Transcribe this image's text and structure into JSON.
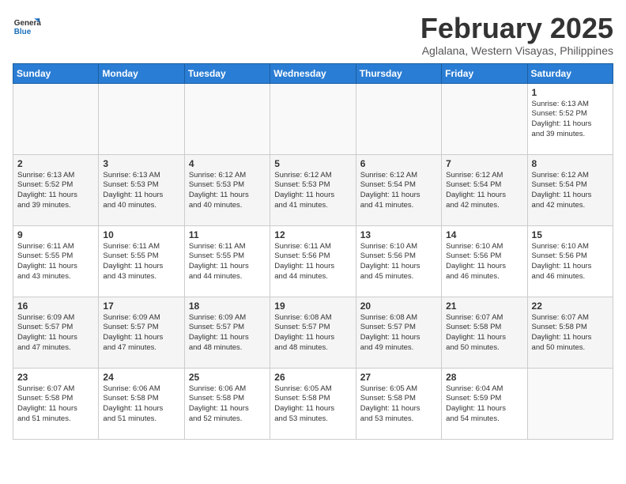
{
  "header": {
    "logo_general": "General",
    "logo_blue": "Blue",
    "title": "February 2025",
    "subtitle": "Aglalana, Western Visayas, Philippines"
  },
  "weekdays": [
    "Sunday",
    "Monday",
    "Tuesday",
    "Wednesday",
    "Thursday",
    "Friday",
    "Saturday"
  ],
  "weeks": [
    [
      {
        "day": "",
        "info": ""
      },
      {
        "day": "",
        "info": ""
      },
      {
        "day": "",
        "info": ""
      },
      {
        "day": "",
        "info": ""
      },
      {
        "day": "",
        "info": ""
      },
      {
        "day": "",
        "info": ""
      },
      {
        "day": "1",
        "info": "Sunrise: 6:13 AM\nSunset: 5:52 PM\nDaylight: 11 hours\nand 39 minutes."
      }
    ],
    [
      {
        "day": "2",
        "info": "Sunrise: 6:13 AM\nSunset: 5:52 PM\nDaylight: 11 hours\nand 39 minutes."
      },
      {
        "day": "3",
        "info": "Sunrise: 6:13 AM\nSunset: 5:53 PM\nDaylight: 11 hours\nand 40 minutes."
      },
      {
        "day": "4",
        "info": "Sunrise: 6:12 AM\nSunset: 5:53 PM\nDaylight: 11 hours\nand 40 minutes."
      },
      {
        "day": "5",
        "info": "Sunrise: 6:12 AM\nSunset: 5:53 PM\nDaylight: 11 hours\nand 41 minutes."
      },
      {
        "day": "6",
        "info": "Sunrise: 6:12 AM\nSunset: 5:54 PM\nDaylight: 11 hours\nand 41 minutes."
      },
      {
        "day": "7",
        "info": "Sunrise: 6:12 AM\nSunset: 5:54 PM\nDaylight: 11 hours\nand 42 minutes."
      },
      {
        "day": "8",
        "info": "Sunrise: 6:12 AM\nSunset: 5:54 PM\nDaylight: 11 hours\nand 42 minutes."
      }
    ],
    [
      {
        "day": "9",
        "info": "Sunrise: 6:11 AM\nSunset: 5:55 PM\nDaylight: 11 hours\nand 43 minutes."
      },
      {
        "day": "10",
        "info": "Sunrise: 6:11 AM\nSunset: 5:55 PM\nDaylight: 11 hours\nand 43 minutes."
      },
      {
        "day": "11",
        "info": "Sunrise: 6:11 AM\nSunset: 5:55 PM\nDaylight: 11 hours\nand 44 minutes."
      },
      {
        "day": "12",
        "info": "Sunrise: 6:11 AM\nSunset: 5:56 PM\nDaylight: 11 hours\nand 44 minutes."
      },
      {
        "day": "13",
        "info": "Sunrise: 6:10 AM\nSunset: 5:56 PM\nDaylight: 11 hours\nand 45 minutes."
      },
      {
        "day": "14",
        "info": "Sunrise: 6:10 AM\nSunset: 5:56 PM\nDaylight: 11 hours\nand 46 minutes."
      },
      {
        "day": "15",
        "info": "Sunrise: 6:10 AM\nSunset: 5:56 PM\nDaylight: 11 hours\nand 46 minutes."
      }
    ],
    [
      {
        "day": "16",
        "info": "Sunrise: 6:09 AM\nSunset: 5:57 PM\nDaylight: 11 hours\nand 47 minutes."
      },
      {
        "day": "17",
        "info": "Sunrise: 6:09 AM\nSunset: 5:57 PM\nDaylight: 11 hours\nand 47 minutes."
      },
      {
        "day": "18",
        "info": "Sunrise: 6:09 AM\nSunset: 5:57 PM\nDaylight: 11 hours\nand 48 minutes."
      },
      {
        "day": "19",
        "info": "Sunrise: 6:08 AM\nSunset: 5:57 PM\nDaylight: 11 hours\nand 48 minutes."
      },
      {
        "day": "20",
        "info": "Sunrise: 6:08 AM\nSunset: 5:57 PM\nDaylight: 11 hours\nand 49 minutes."
      },
      {
        "day": "21",
        "info": "Sunrise: 6:07 AM\nSunset: 5:58 PM\nDaylight: 11 hours\nand 50 minutes."
      },
      {
        "day": "22",
        "info": "Sunrise: 6:07 AM\nSunset: 5:58 PM\nDaylight: 11 hours\nand 50 minutes."
      }
    ],
    [
      {
        "day": "23",
        "info": "Sunrise: 6:07 AM\nSunset: 5:58 PM\nDaylight: 11 hours\nand 51 minutes."
      },
      {
        "day": "24",
        "info": "Sunrise: 6:06 AM\nSunset: 5:58 PM\nDaylight: 11 hours\nand 51 minutes."
      },
      {
        "day": "25",
        "info": "Sunrise: 6:06 AM\nSunset: 5:58 PM\nDaylight: 11 hours\nand 52 minutes."
      },
      {
        "day": "26",
        "info": "Sunrise: 6:05 AM\nSunset: 5:58 PM\nDaylight: 11 hours\nand 53 minutes."
      },
      {
        "day": "27",
        "info": "Sunrise: 6:05 AM\nSunset: 5:58 PM\nDaylight: 11 hours\nand 53 minutes."
      },
      {
        "day": "28",
        "info": "Sunrise: 6:04 AM\nSunset: 5:59 PM\nDaylight: 11 hours\nand 54 minutes."
      },
      {
        "day": "",
        "info": ""
      }
    ]
  ]
}
